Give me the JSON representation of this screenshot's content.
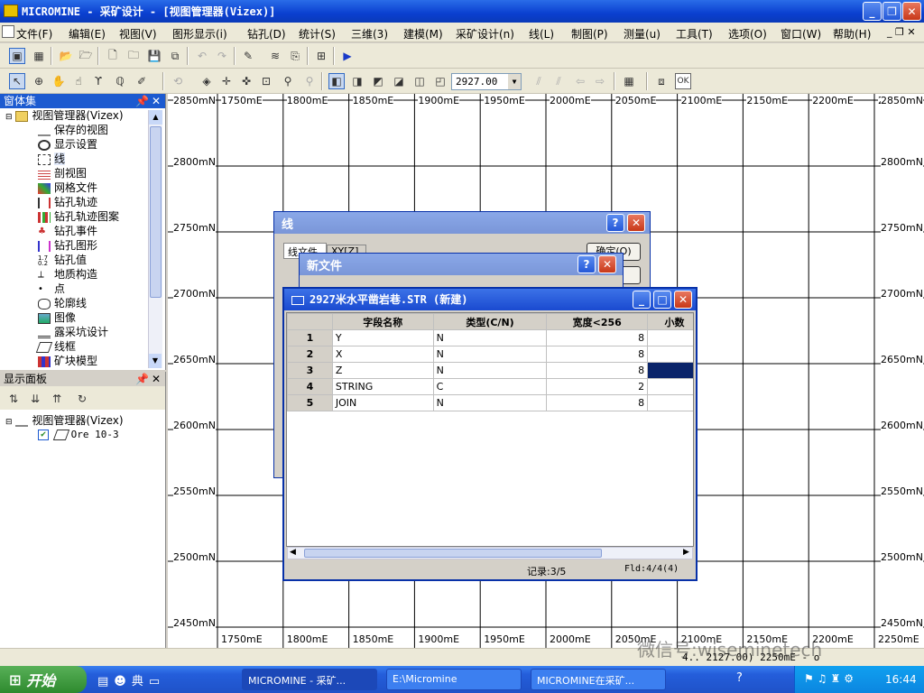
{
  "window": {
    "title": "MICROMINE - 采矿设计 - [视图管理器(Vizex)]"
  },
  "menu": [
    "文件(F)",
    "编辑(E)",
    "视图(V)",
    "图形显示(i)",
    "钻孔(D)",
    "统计(S)",
    "三维(3)",
    "建模(M)",
    "采矿设计(n)",
    "线(L)",
    "制图(P)",
    "测量(u)",
    "工具(T)",
    "选项(O)",
    "窗口(W)",
    "帮助(H)"
  ],
  "toolbar2": {
    "elevation": "2927.00"
  },
  "sidebar": {
    "title": "窗体集",
    "root": "视图管理器(Vizex)",
    "items": [
      "保存的视图",
      "显示设置",
      "线",
      "剖视图",
      "网格文件",
      "钻孔轨迹",
      "钻孔轨迹图案",
      "钻孔事件",
      "钻孔图形",
      "钻孔值",
      "地质构造",
      "点",
      "轮廓线",
      "图像",
      "露采坑设计",
      "线框",
      "矿块模型"
    ]
  },
  "display_panel": {
    "title": "显示面板",
    "root": "视图管理器(Vizex)",
    "layer": "Ore 10-3"
  },
  "map": {
    "x_labels": [
      "1750mE",
      "1800mE",
      "1850mE",
      "1900mE",
      "1950mE",
      "2000mE",
      "2050mE",
      "2100mE",
      "2150mE",
      "2200mE",
      "2250mE"
    ],
    "y_labels": [
      "2850mN",
      "2800mN",
      "2750mN",
      "2700mN",
      "2650mN",
      "2600mN",
      "2550mN",
      "2500mN",
      "2450mN"
    ]
  },
  "dialog_line": {
    "title": "线",
    "tab1": "线文件",
    "tab2": "XY[Z]",
    "ok_label": "确定(O)"
  },
  "dialog_newfile": {
    "title": "新文件"
  },
  "dialog_table": {
    "title": "2927米水平凿岩巷.STR (新建)",
    "columns": [
      "字段名称",
      "类型(C/N)",
      "宽度<256",
      "小数"
    ],
    "rows": [
      {
        "no": "1",
        "name": "Y",
        "type": "N",
        "width": "8"
      },
      {
        "no": "2",
        "name": "X",
        "type": "N",
        "width": "8"
      },
      {
        "no": "3",
        "name": "Z",
        "type": "N",
        "width": "8"
      },
      {
        "no": "4",
        "name": "STRING",
        "type": "C",
        "width": "2"
      },
      {
        "no": "5",
        "name": "JOIN",
        "type": "N",
        "width": "8"
      }
    ],
    "status_record": "记录:3/5",
    "status_field": "Fld:4/4(4)"
  },
  "statusbar": {
    "coords": "4.. 2127.00) 2250mE - o"
  },
  "watermark": "微信号:wiseminetech",
  "taskbar": {
    "start": "开始",
    "tasks": [
      "MICROMINE - 采矿...",
      "E:\\Micromine",
      "MICROMINE在采矿..."
    ],
    "clock": "16:44"
  }
}
